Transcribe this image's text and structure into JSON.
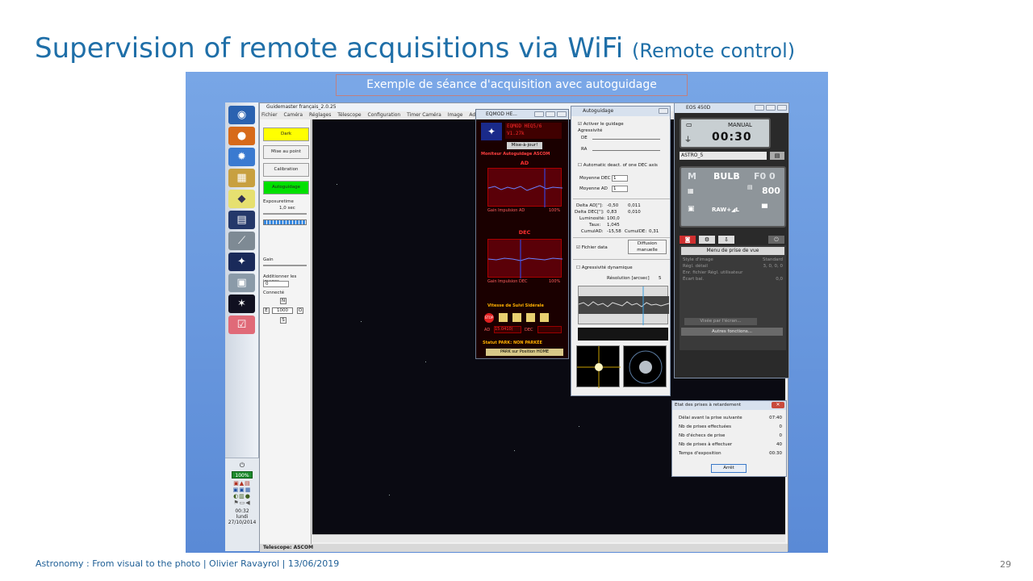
{
  "slide": {
    "title": "Supervision of remote acquisitions via WiFi",
    "subtitle": "(Remote control)",
    "footer": "Astronomy : From visual to the photo | Olivier Ravayrol | 13/06/2019",
    "page_number": "29"
  },
  "screenshot": {
    "caption": "Exemple de séance d'acquisition avec autoguidage",
    "taskbar": {
      "battery": "100%",
      "time": "00:32",
      "day": "lundi",
      "date": "27/10/2014"
    },
    "guidemaster": {
      "title": "Guidemaster français_2.0.25",
      "menu": [
        "Fichier",
        "Caméra",
        "Réglages",
        "Télescope",
        "Configuration",
        "Timer Caméra",
        "Image",
        "Adva"
      ],
      "buttons": {
        "dark": "Dark",
        "focus": "Mise au point",
        "calibration": "Calibration",
        "autoguide": "Autoguidage"
      },
      "exposure_label": "Exposuretime",
      "exposure_value": "1,0 sec",
      "gain_label": "Gain",
      "add_images_label": "Additionner les images",
      "add_images_value": "0",
      "connected_label": "Connecté",
      "n": "N",
      "s": "S",
      "e": "E",
      "o": "O",
      "step_value": "1000",
      "status": "Telescope: ASCOM",
      "colors": {
        "dark_btn": "#ffff00",
        "autoguide_btn": "#00e000"
      }
    },
    "eqmod": {
      "title": "EQMOD HE...",
      "coords_line1": "EQMOD HEQ5/6",
      "coords_line2": "V1.27k",
      "update_btn": "Mise-à-jour!",
      "monitor_label": "Moniteur Autoguidage ASCOM",
      "ad_label": "AD",
      "dec_label": "DEC",
      "gain_ad_label": "Gain Impulsion AD",
      "gain_ad_value": "100%",
      "gain_dec_label": "Gain Impulsion DEC",
      "gain_dec_value": "100%",
      "sidereal_label": "Vitesse de Suivi Sidérale",
      "ad_field": "AD",
      "ad_rate": "15.0410(",
      "dec_field": "DEC",
      "park_status": "Statut PARK: NON PARKÉE",
      "park_btn": "PARK sur Position HOME",
      "stop": "STOP"
    },
    "autoguidage": {
      "title": "Autoguidage",
      "enable_label": "Activer le guidage",
      "aggressivity": "Agressivité",
      "de": "DE",
      "ra": "RA",
      "auto_deact": "Automatic deact. of one DEC axis",
      "moyenne_dec_label": "Moyenne DEC",
      "moyenne_dec": "1",
      "moyenne_ad_label": "Moyenne  AD",
      "moyenne_ad": "1",
      "delta_ad_label": "Delta AD[\"]:",
      "delta_ad_1": "-0,50",
      "delta_ad_2": "0,011",
      "delta_dec_label": "Delta DEC[\"]:",
      "delta_dec_1": "0,83",
      "delta_dec_2": "0,010",
      "lum_label": "Luminosité:",
      "lum_value": "100,0",
      "taux_label": "Taux:",
      "taux_value": "1,045",
      "cumul_ad_label": "CumulAD:",
      "cumul_ad_value": "-15,58",
      "cumul_de_label": "CumulDE:",
      "cumul_de_value": "0,31",
      "fichier_data": "Fichier data",
      "diffusion": "Diffusion manuelle",
      "dyn_agg": "Agressivité dynamique",
      "resolution_label": "Résolution [arcsec]",
      "resolution_value": "5"
    },
    "eos": {
      "title": "EOS 450D",
      "mode": "MANUAL",
      "timer": "00:30",
      "profile": "ASTRO_5",
      "m": "M",
      "bulb": "BULB",
      "aperture": "F0 0",
      "iso": "800",
      "raw": "RAW+◢L",
      "menu_title": "Menu de prise de vue",
      "menu_items": [
        {
          "label": "Style d'image",
          "value": "Standard"
        },
        {
          "label": "Régl. détail",
          "value": "3, 0, 0, 0"
        },
        {
          "label": "Enr. fichier Régl. utilisateur",
          "value": ""
        },
        {
          "label": "Écart bal.",
          "value": "0,0"
        }
      ],
      "live_view": "Visée par l'écran...",
      "other_functions": "Autres fonctions..."
    },
    "etat_prises": {
      "title": "Etat des prises à retardement",
      "close": "✕",
      "rows": [
        {
          "label": "Délai avant la prise suivante",
          "value": "07:40"
        },
        {
          "label": "Nb de prises effectuées",
          "value": "0"
        },
        {
          "label": "Nb d'échecs de prise",
          "value": "0"
        },
        {
          "label": "Nb de prises à effectuer",
          "value": "40"
        },
        {
          "label": "Temps d'exposition",
          "value": "00:30"
        }
      ],
      "stop_btn": "Arrêt"
    }
  }
}
